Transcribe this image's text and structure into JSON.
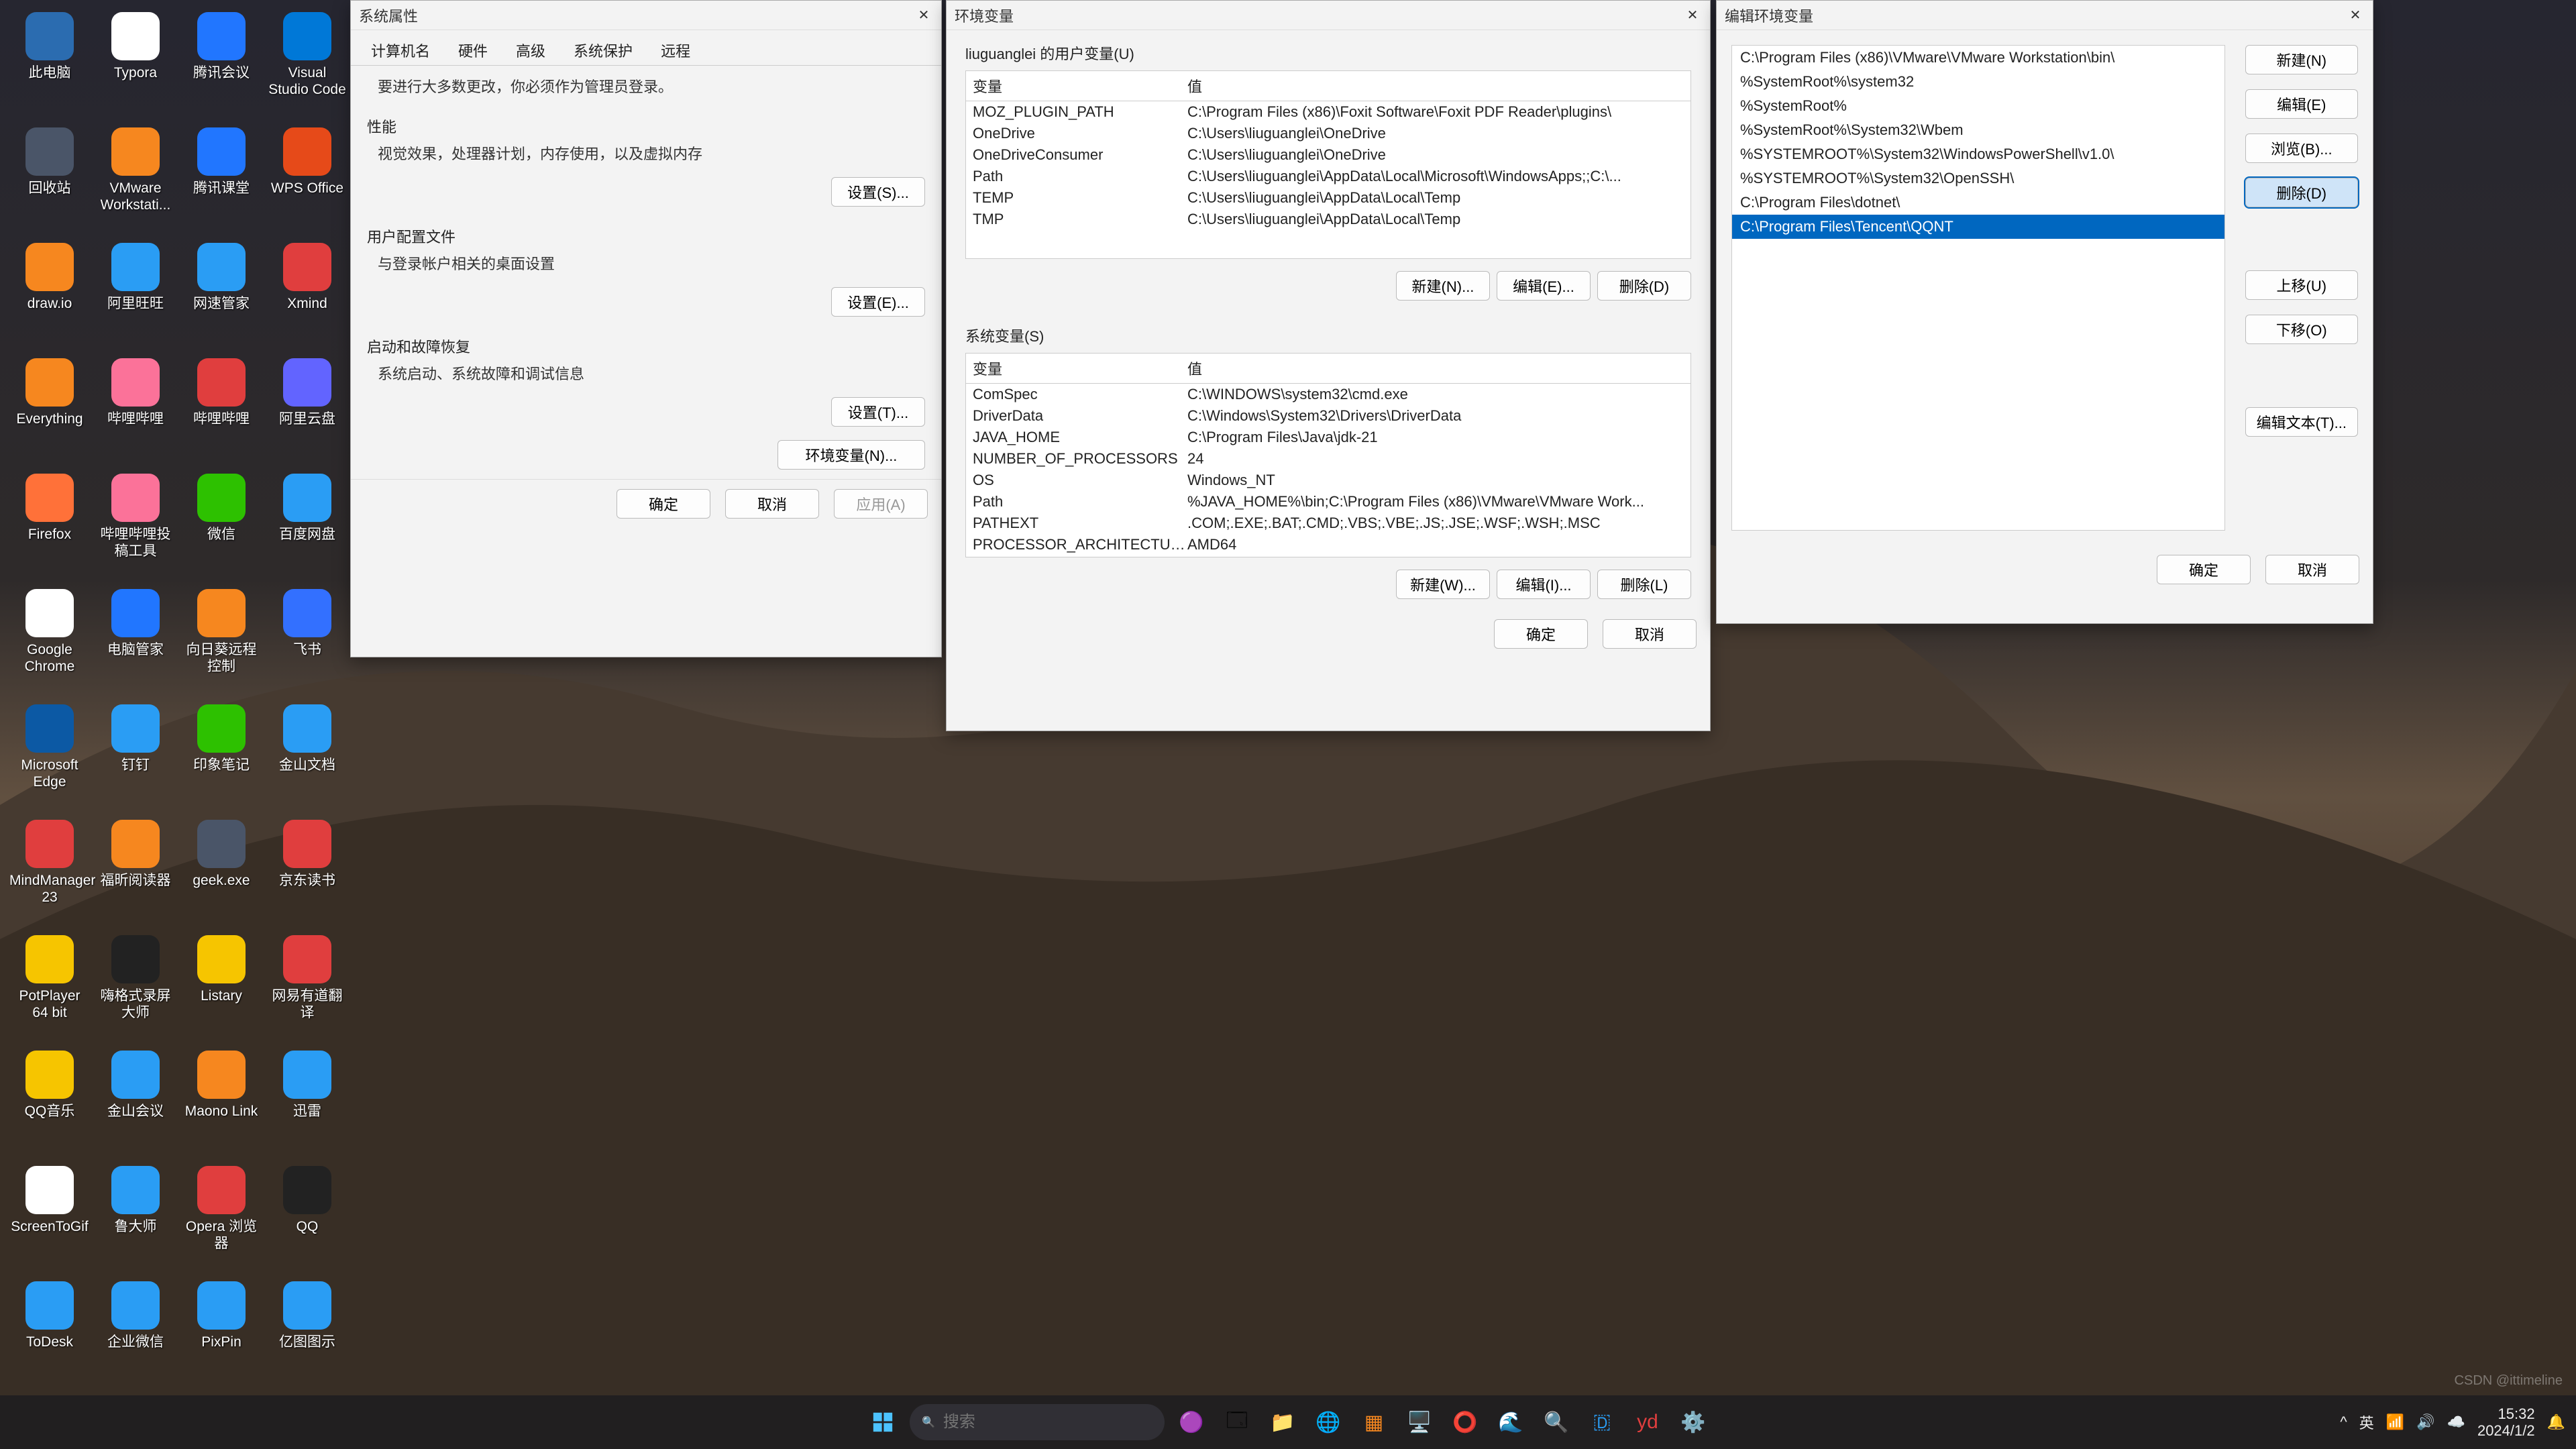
{
  "desktop_icons": [
    [
      {
        "label": "此电脑",
        "color": "#2b6cb0"
      },
      {
        "label": "Typora",
        "color": "#fff"
      },
      {
        "label": "腾讯会议",
        "color": "#2176ff"
      },
      {
        "label": "Visual Studio Code",
        "color": "#0078d7"
      }
    ],
    [
      {
        "label": "回收站",
        "color": "#4a5568"
      },
      {
        "label": "VMware Workstati...",
        "color": "#f6871f"
      },
      {
        "label": "腾讯课堂",
        "color": "#2176ff"
      },
      {
        "label": "WPS Office",
        "color": "#e64a19"
      }
    ],
    [
      {
        "label": "draw.io",
        "color": "#f6871f"
      },
      {
        "label": "阿里旺旺",
        "color": "#2a9df4"
      },
      {
        "label": "网速管家",
        "color": "#2a9df4"
      },
      {
        "label": "Xmind",
        "color": "#e03e3e"
      }
    ],
    [
      {
        "label": "Everything",
        "color": "#f6871f"
      },
      {
        "label": "哔哩哔哩",
        "color": "#fb7299"
      },
      {
        "label": "哔哩哔哩",
        "color": "#e03e3e"
      },
      {
        "label": "阿里云盘",
        "color": "#6264ff"
      }
    ],
    [
      {
        "label": "Firefox",
        "color": "#ff7139"
      },
      {
        "label": "哔哩哔哩投稿工具",
        "color": "#fb7299"
      },
      {
        "label": "微信",
        "color": "#2dc100"
      },
      {
        "label": "百度网盘",
        "color": "#2a9df4"
      }
    ],
    [
      {
        "label": "Google Chrome",
        "color": "#fff"
      },
      {
        "label": "电脑管家",
        "color": "#2176ff"
      },
      {
        "label": "向日葵远程控制",
        "color": "#f6871f"
      },
      {
        "label": "飞书",
        "color": "#3370ff"
      }
    ],
    [
      {
        "label": "Microsoft Edge",
        "color": "#0c59a4"
      },
      {
        "label": "钉钉",
        "color": "#2a9df4"
      },
      {
        "label": "印象笔记",
        "color": "#2dc100"
      },
      {
        "label": "金山文档",
        "color": "#2a9df4"
      }
    ],
    [
      {
        "label": "MindManager 23",
        "color": "#e03e3e"
      },
      {
        "label": "福昕阅读器",
        "color": "#f6871f"
      },
      {
        "label": "geek.exe",
        "color": "#4a5568"
      },
      {
        "label": "京东读书",
        "color": "#e03e3e"
      }
    ],
    [
      {
        "label": "PotPlayer 64 bit",
        "color": "#f6c500"
      },
      {
        "label": "嗨格式录屏大师",
        "color": "#222"
      },
      {
        "label": "Listary",
        "color": "#f6c500"
      },
      {
        "label": "网易有道翻译",
        "color": "#e03e3e"
      }
    ],
    [
      {
        "label": "QQ音乐",
        "color": "#f6c500"
      },
      {
        "label": "金山会议",
        "color": "#2a9df4"
      },
      {
        "label": "Maono Link",
        "color": "#f6871f"
      },
      {
        "label": "迅雷",
        "color": "#2a9df4"
      }
    ],
    [
      {
        "label": "ScreenToGif",
        "color": "#fff"
      },
      {
        "label": "鲁大师",
        "color": "#2a9df4"
      },
      {
        "label": "Opera 浏览器",
        "color": "#e03e3e"
      },
      {
        "label": "QQ",
        "color": "#222"
      }
    ],
    [
      {
        "label": "ToDesk",
        "color": "#2a9df4"
      },
      {
        "label": "企业微信",
        "color": "#2a9df4"
      },
      {
        "label": "PixPin",
        "color": "#2a9df4"
      },
      {
        "label": "亿图图示",
        "color": "#2a9df4"
      }
    ]
  ],
  "sysprops": {
    "title": "系统属性",
    "tabs": [
      "计算机名",
      "硬件",
      "高级",
      "系统保护",
      "远程"
    ],
    "active_tab": 2,
    "admin_note": "要进行大多数更改，你必须作为管理员登录。",
    "perf": {
      "title": "性能",
      "desc": "视觉效果，处理器计划，内存使用，以及虚拟内存",
      "btn": "设置(S)..."
    },
    "userprof": {
      "title": "用户配置文件",
      "desc": "与登录帐户相关的桌面设置",
      "btn": "设置(E)..."
    },
    "startup": {
      "title": "启动和故障恢复",
      "desc": "系统启动、系统故障和调试信息",
      "btn": "设置(T)..."
    },
    "envbtn": "环境变量(N)...",
    "ok": "确定",
    "cancel": "取消",
    "apply": "应用(A)"
  },
  "envvars": {
    "title": "环境变量",
    "user_section": "liuguanglei 的用户变量(U)",
    "col_var": "变量",
    "col_val": "值",
    "user_rows": [
      {
        "v": "MOZ_PLUGIN_PATH",
        "val": "C:\\Program Files (x86)\\Foxit Software\\Foxit PDF Reader\\plugins\\"
      },
      {
        "v": "OneDrive",
        "val": "C:\\Users\\liuguanglei\\OneDrive"
      },
      {
        "v": "OneDriveConsumer",
        "val": "C:\\Users\\liuguanglei\\OneDrive"
      },
      {
        "v": "Path",
        "val": "C:\\Users\\liuguanglei\\AppData\\Local\\Microsoft\\WindowsApps;;C:\\..."
      },
      {
        "v": "TEMP",
        "val": "C:\\Users\\liuguanglei\\AppData\\Local\\Temp"
      },
      {
        "v": "TMP",
        "val": "C:\\Users\\liuguanglei\\AppData\\Local\\Temp"
      }
    ],
    "sys_section": "系统变量(S)",
    "sys_rows": [
      {
        "v": "ComSpec",
        "val": "C:\\WINDOWS\\system32\\cmd.exe"
      },
      {
        "v": "DriverData",
        "val": "C:\\Windows\\System32\\Drivers\\DriverData"
      },
      {
        "v": "JAVA_HOME",
        "val": "C:\\Program Files\\Java\\jdk-21"
      },
      {
        "v": "NUMBER_OF_PROCESSORS",
        "val": "24"
      },
      {
        "v": "OS",
        "val": "Windows_NT"
      },
      {
        "v": "Path",
        "val": "%JAVA_HOME%\\bin;C:\\Program Files (x86)\\VMware\\VMware Work..."
      },
      {
        "v": "PATHEXT",
        "val": ".COM;.EXE;.BAT;.CMD;.VBS;.VBE;.JS;.JSE;.WSF;.WSH;.MSC"
      },
      {
        "v": "PROCESSOR_ARCHITECTURE",
        "val": "AMD64"
      }
    ],
    "new_u": "新建(N)...",
    "edit_u": "编辑(E)...",
    "del_u": "删除(D)",
    "new_s": "新建(W)...",
    "edit_s": "编辑(I)...",
    "del_s": "删除(L)",
    "ok": "确定",
    "cancel": "取消"
  },
  "editpath": {
    "title": "编辑环境变量",
    "items": [
      "C:\\Program Files (x86)\\VMware\\VMware Workstation\\bin\\",
      "%SystemRoot%\\system32",
      "%SystemRoot%",
      "%SystemRoot%\\System32\\Wbem",
      "%SYSTEMROOT%\\System32\\WindowsPowerShell\\v1.0\\",
      "%SYSTEMROOT%\\System32\\OpenSSH\\",
      "C:\\Program Files\\dotnet\\",
      "C:\\Program Files\\Tencent\\QQNT"
    ],
    "selected": 7,
    "btn_new": "新建(N)",
    "btn_edit": "编辑(E)",
    "btn_browse": "浏览(B)...",
    "btn_delete": "删除(D)",
    "btn_up": "上移(U)",
    "btn_down": "下移(O)",
    "btn_edittext": "编辑文本(T)...",
    "ok": "确定",
    "cancel": "取消"
  },
  "taskbar": {
    "search_placeholder": "搜索",
    "time": "15:32",
    "date": "2024/1/2",
    "lang": "英"
  },
  "watermark": "CSDN @ittimeline"
}
